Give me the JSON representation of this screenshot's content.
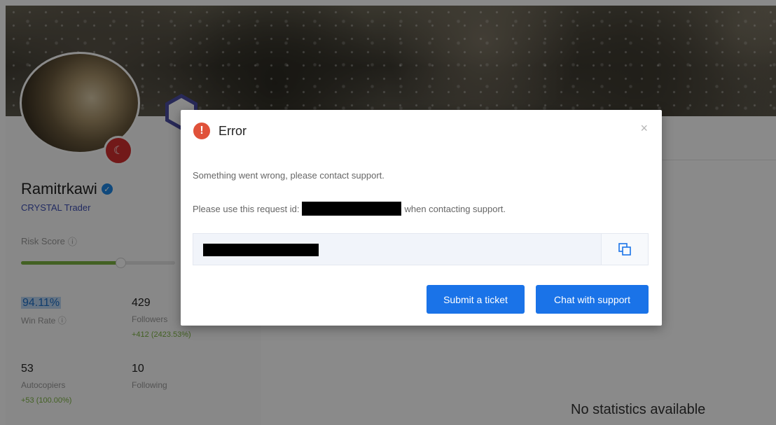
{
  "profile": {
    "username": "Ramitrkawi",
    "rank": "CRYSTAL Trader",
    "risk_score_label": "Risk Score",
    "risk_level": 0.64,
    "flag_icon": "turkey-flag-icon",
    "verified_icon": "verified-check-icon",
    "stats": {
      "win_rate_value": "94.11%",
      "win_rate_label": "Win Rate",
      "followers_value": "429",
      "followers_label": "Followers",
      "followers_change": "+412 (2423.53%)",
      "autocopiers_value": "53",
      "autocopiers_label": "Autocopiers",
      "autocopiers_change": "+53 (100.00%)",
      "following_value": "10",
      "following_label": "Following"
    }
  },
  "main": {
    "no_stats_text": "No statistics available"
  },
  "modal": {
    "title": "Error",
    "close_icon": "×",
    "message": "Something went wrong, please contact support.",
    "request_prefix": "Please use this request id:",
    "request_suffix": "when contacting support.",
    "submit_ticket_label": "Submit a ticket",
    "chat_support_label": "Chat with support",
    "accent_color": "#1a73e8",
    "error_color": "#e0523a"
  }
}
